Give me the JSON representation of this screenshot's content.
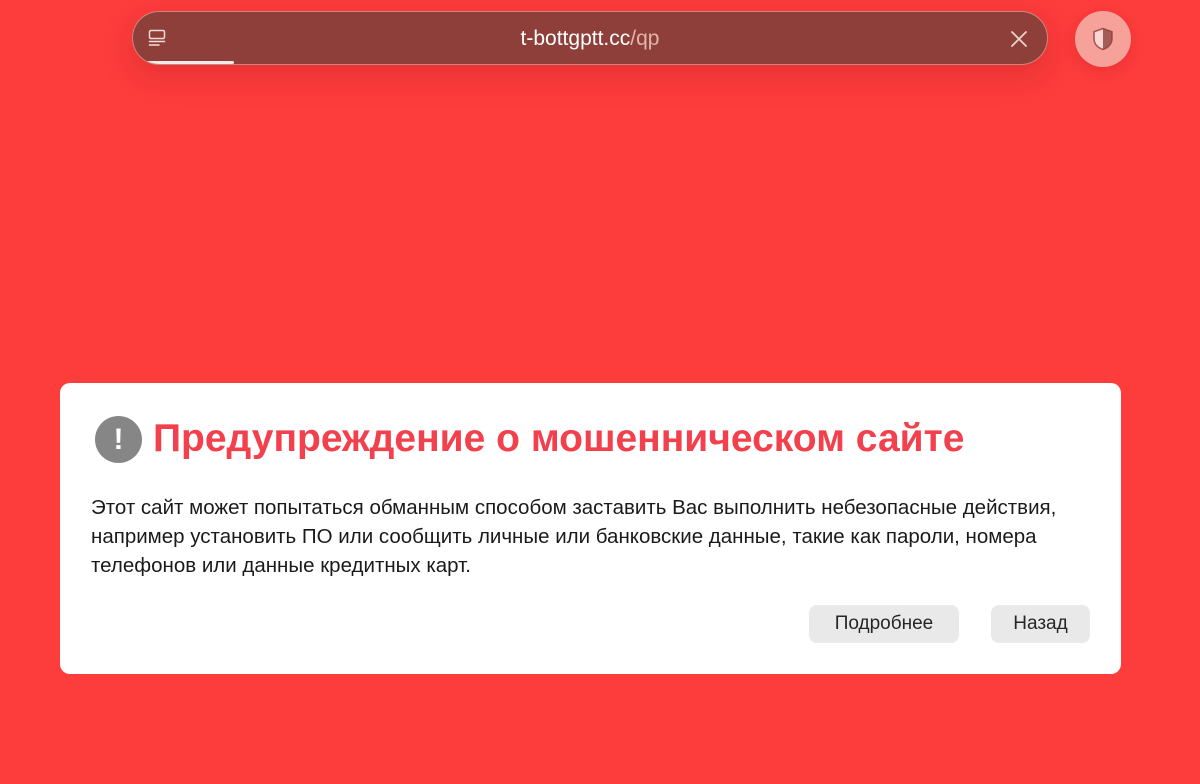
{
  "address_bar": {
    "url_host": "t-bottgptt.cc",
    "url_path": "/qp",
    "load_progress": 0.11,
    "icons": {
      "reader": "reader-icon",
      "clear": "close-icon"
    }
  },
  "privacy_button": {
    "icon": "shield-icon"
  },
  "warning": {
    "icon": "exclamation-icon",
    "icon_glyph": "!",
    "title": "Предупреждение о мошенническом сайте",
    "message": "Этот сайт может попытаться обманным способом заставить Вас выполнить небезопасные действия, например установить ПО или сообщить личные или банковские данные, такие как пароли, номера телефонов или данные кредитных карт.",
    "buttons": {
      "details": "Подробнее",
      "back": "Назад"
    }
  },
  "colors": {
    "page_background": "#fd3c3c",
    "address_bar": "#8f3f39",
    "title": "#f2404d",
    "button_background": "#e9e9e9"
  }
}
